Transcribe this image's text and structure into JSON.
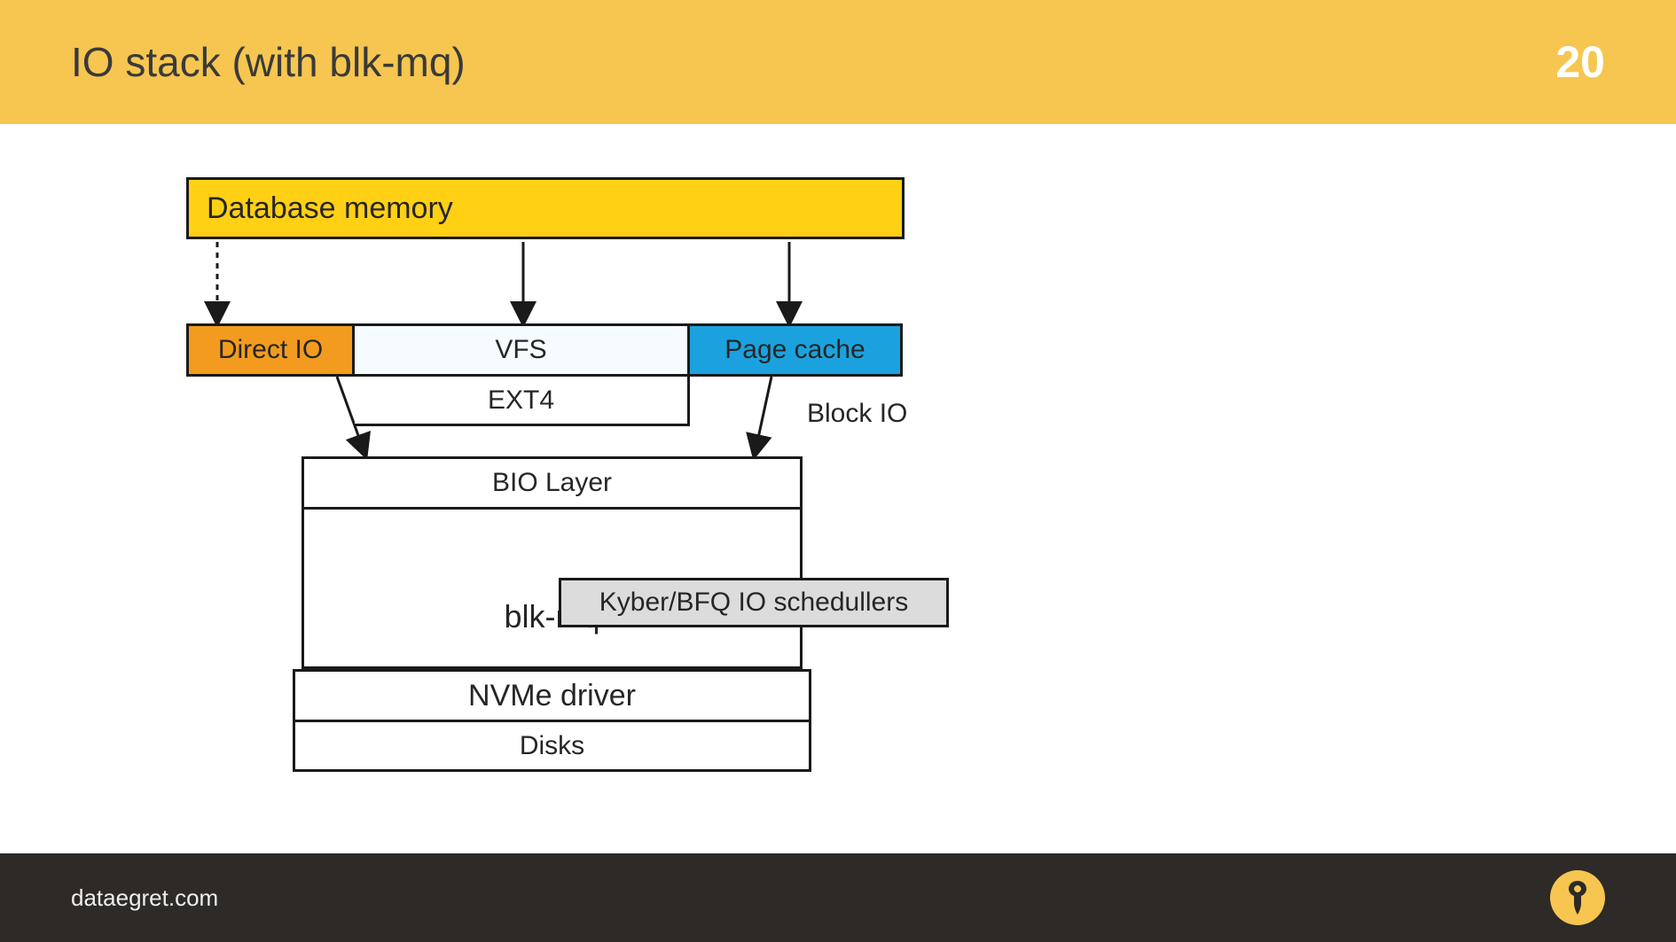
{
  "header": {
    "title": "IO stack (with blk-mq)",
    "page": "20"
  },
  "footer": {
    "url": "dataegret.com"
  },
  "diagram": {
    "db": "Database memory",
    "dio": "Direct IO",
    "vfs": "VFS",
    "ext4": "EXT4",
    "pgc": "Page cache",
    "bio": "BIO Layer",
    "sched": "Kyber/BFQ IO schedullers",
    "blkmq": "blk-mq",
    "nvme": "NVMe driver",
    "disks": "Disks",
    "block_io": "Block IO"
  }
}
